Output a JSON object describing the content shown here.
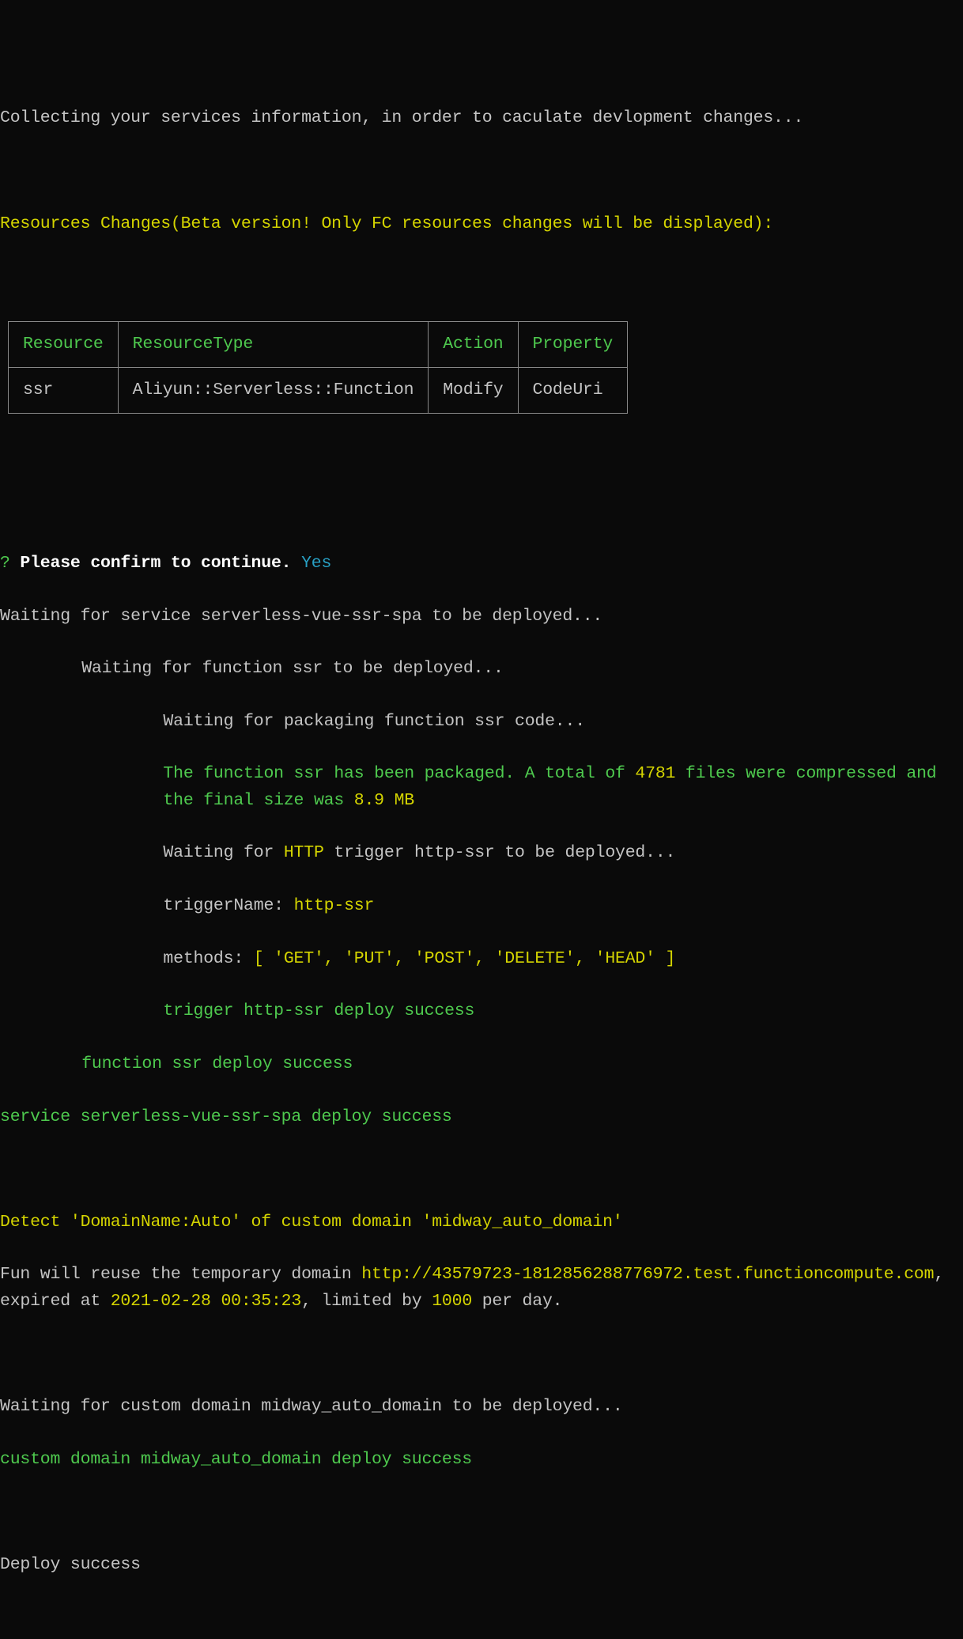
{
  "collecting": "Collecting your services information, in order to caculate devlopment changes...",
  "resources_header": "Resources Changes(Beta version! Only FC resources changes will be displayed):",
  "table": {
    "headers": {
      "resource": "Resource",
      "type": "ResourceType",
      "action": "Action",
      "property": "Property"
    },
    "row": {
      "resource": "ssr",
      "type": "Aliyun::Serverless::Function",
      "action": "Modify",
      "property": "CodeUri"
    }
  },
  "prompt": {
    "q": "?",
    "text": "Please confirm to continue.",
    "answer": "Yes"
  },
  "deploy": {
    "l1": "Waiting for service serverless-vue-ssr-spa to be deployed...",
    "l2": "Waiting for function ssr to be deployed...",
    "l3": "Waiting for packaging function ssr code...",
    "pkg_a": "The function ssr has been packaged. A total of ",
    "pkg_files": "4781",
    "pkg_b": " files were compressed and the final size was ",
    "pkg_size": "8.9 MB",
    "trig_a": "Waiting for ",
    "trig_http": "HTTP",
    "trig_b": " trigger http-ssr to be deployed...",
    "tname_a": "triggerName: ",
    "tname_b": "http-ssr",
    "methods_a": "methods: ",
    "methods_b": "[ 'GET', 'PUT', 'POST', 'DELETE', 'HEAD' ]",
    "trig_success": "trigger http-ssr deploy success",
    "fn_success": "function ssr deploy success",
    "svc_success": "service serverless-vue-ssr-spa deploy success"
  },
  "domain": {
    "detect": "Detect 'DomainName:Auto' of custom domain 'midway_auto_domain'",
    "reuse_a": "Fun will reuse the temporary domain ",
    "url": "http://43579723-1812856288776972.test.functioncompute.com",
    "reuse_b": ", expired at ",
    "expiry": "2021-02-28 00:35:23",
    "reuse_c": ", limited by ",
    "limit": "1000",
    "reuse_d": " per day.",
    "waiting": "Waiting for custom domain midway_auto_domain to be deployed...",
    "success": "custom domain midway_auto_domain deploy success"
  },
  "final": "Deploy success"
}
